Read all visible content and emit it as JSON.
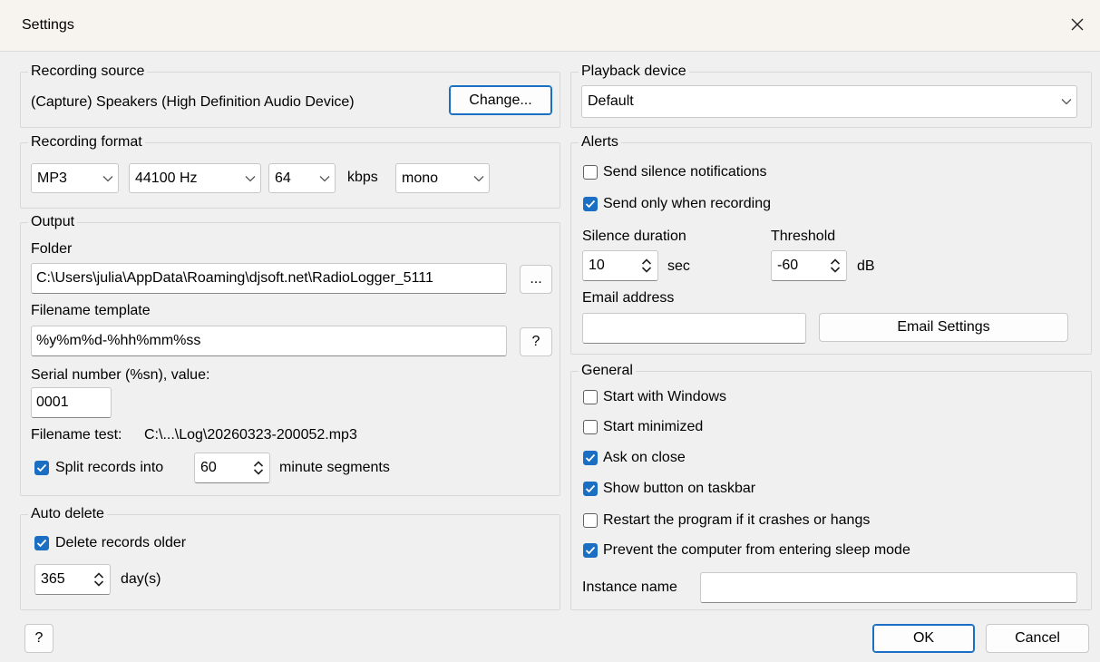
{
  "window": {
    "title": "Settings"
  },
  "recording_source": {
    "group_label": "Recording source",
    "device": "(Capture) Speakers (High Definition Audio Device)",
    "change_button": "Change..."
  },
  "playback_device": {
    "group_label": "Playback device",
    "selected": "Default"
  },
  "recording_format": {
    "group_label": "Recording format",
    "codec": "MP3",
    "sample_rate": "44100 Hz",
    "bitrate": "64",
    "bitrate_unit": "kbps",
    "channels": "mono"
  },
  "alerts": {
    "group_label": "Alerts",
    "send_silence_notifications": {
      "label": "Send silence notifications",
      "checked": false
    },
    "send_only_when_recording": {
      "label": "Send only when recording",
      "checked": true
    },
    "silence_duration_label": "Silence duration",
    "silence_duration_value": "10",
    "silence_duration_unit": "sec",
    "threshold_label": "Threshold",
    "threshold_value": "-60",
    "threshold_unit": "dB",
    "email_label": "Email address",
    "email_value": "",
    "email_settings_button": "Email Settings"
  },
  "output": {
    "group_label": "Output",
    "folder_label": "Folder",
    "folder_value": "C:\\Users\\julia\\AppData\\Roaming\\djsoft.net\\RadioLogger_5111",
    "browse_button": "...",
    "filename_template_label": "Filename template",
    "filename_template_value": "%y%m%d-%hh%mm%ss",
    "help_button": "?",
    "serial_label": "Serial number (%sn), value:",
    "serial_value": "0001",
    "filename_test_label": "Filename test:",
    "filename_test_value": "C:\\...\\Log\\20260323-200052.mp3",
    "split_label": "Split records into",
    "split_checked": true,
    "split_value": "60",
    "split_unit": "minute segments"
  },
  "general": {
    "group_label": "General",
    "options": [
      {
        "label": "Start with Windows",
        "checked": false
      },
      {
        "label": "Start minimized",
        "checked": false
      },
      {
        "label": "Ask on close",
        "checked": true
      },
      {
        "label": "Show button on taskbar",
        "checked": true
      },
      {
        "label": "Restart the program if it crashes or hangs",
        "checked": false
      },
      {
        "label": "Prevent the computer from entering sleep mode",
        "checked": true
      }
    ],
    "instance_name_label": "Instance name",
    "instance_name_value": ""
  },
  "auto_delete": {
    "group_label": "Auto delete",
    "delete_label": "Delete records older",
    "delete_checked": true,
    "days_value": "365",
    "days_unit": "day(s)"
  },
  "footer": {
    "help_button": "?",
    "ok_button": "OK",
    "cancel_button": "Cancel"
  },
  "colors": {
    "accent": "#1a6fc2",
    "background": "#f0f0f0",
    "titlebar": "#f7f3ee"
  }
}
